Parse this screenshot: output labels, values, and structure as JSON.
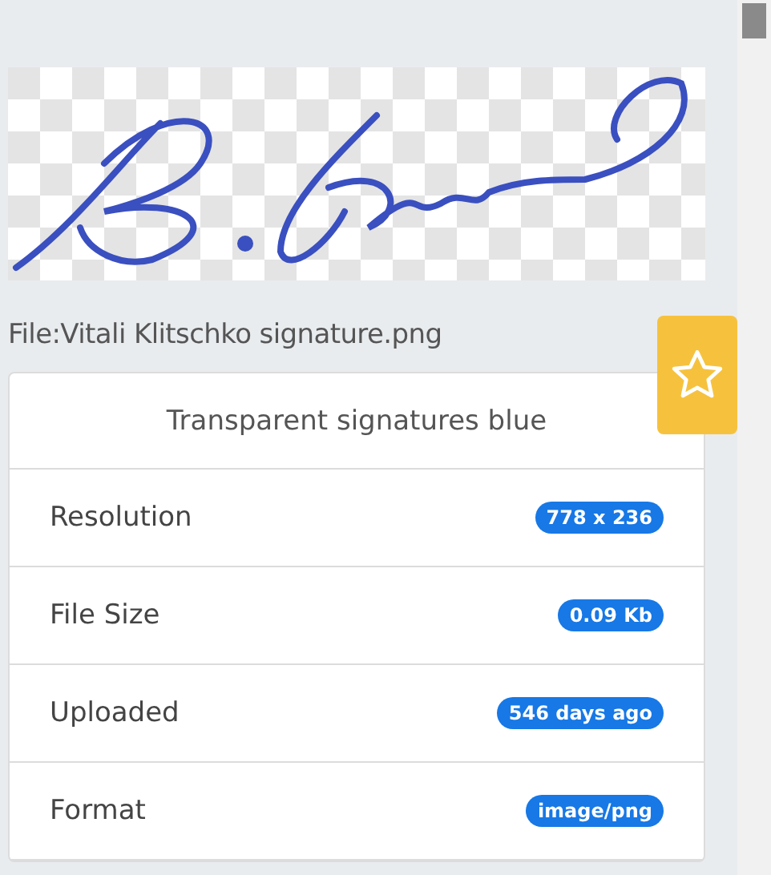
{
  "file_title": "File:Vitali Klitschko signature.png",
  "favorite": {
    "on": false
  },
  "card": {
    "title": "Transparent signatures blue",
    "rows": [
      {
        "label": "Resolution",
        "value": "778 x 236"
      },
      {
        "label": "File Size",
        "value": "0.09 Kb"
      },
      {
        "label": "Uploaded",
        "value": "546 days ago"
      },
      {
        "label": "Format",
        "value": "image/png"
      }
    ]
  }
}
